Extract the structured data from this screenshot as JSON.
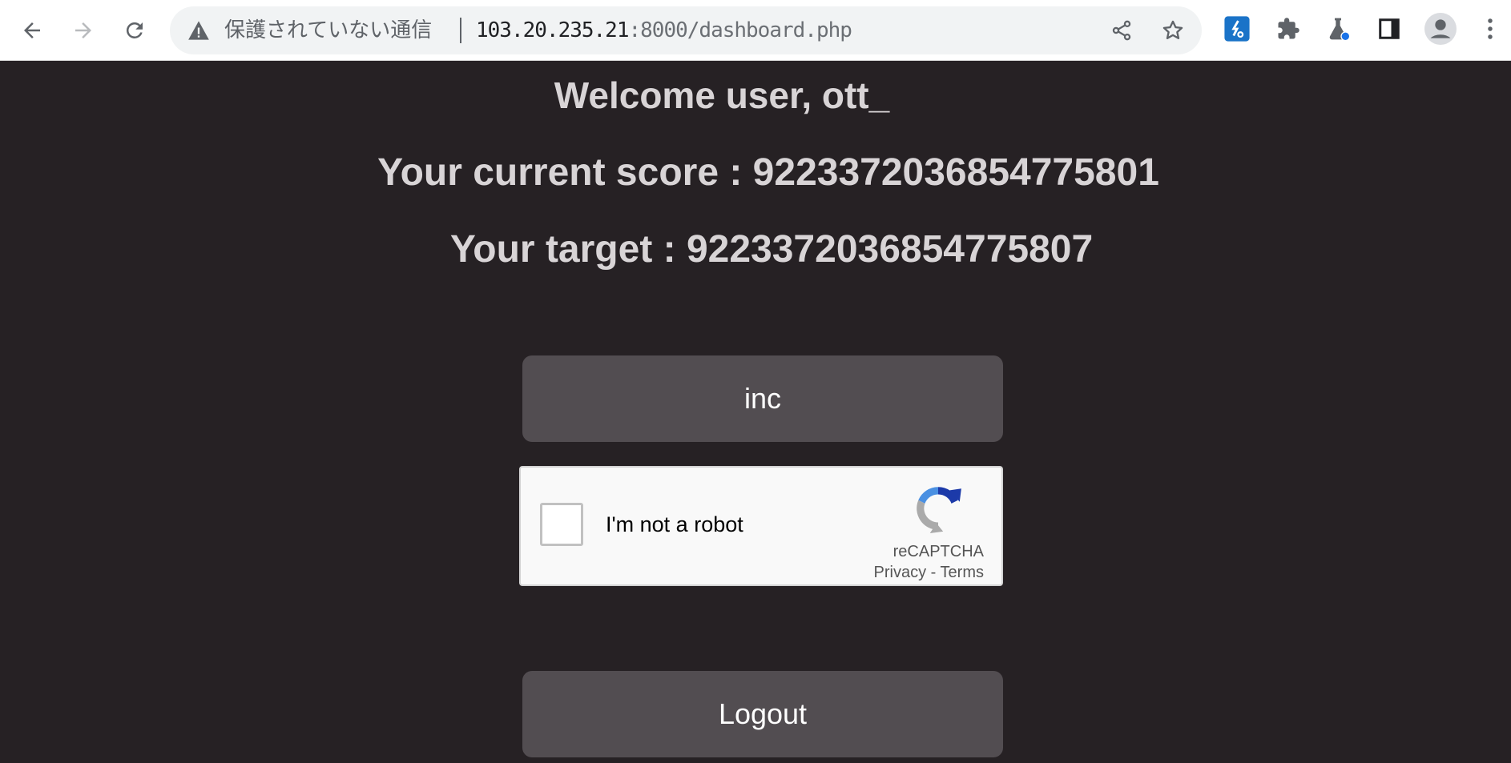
{
  "browser": {
    "security_label": "保護されていない通信",
    "url_host": "103.20.235.21",
    "url_path": ":8000/dashboard.php"
  },
  "page": {
    "welcome": "Welcome user, ott_",
    "score": "Your current score : 9223372036854775801",
    "target": "Your target : 9223372036854775807",
    "inc_label": "inc",
    "logout_label": "Logout"
  },
  "captcha": {
    "label": "I'm not a robot",
    "brand": "reCAPTCHA",
    "privacy": "Privacy",
    "separator": " - ",
    "terms": "Terms"
  },
  "colors": {
    "page_bg": "#262124",
    "button_bg": "#524d51",
    "heading_text": "#d8d4d6"
  }
}
